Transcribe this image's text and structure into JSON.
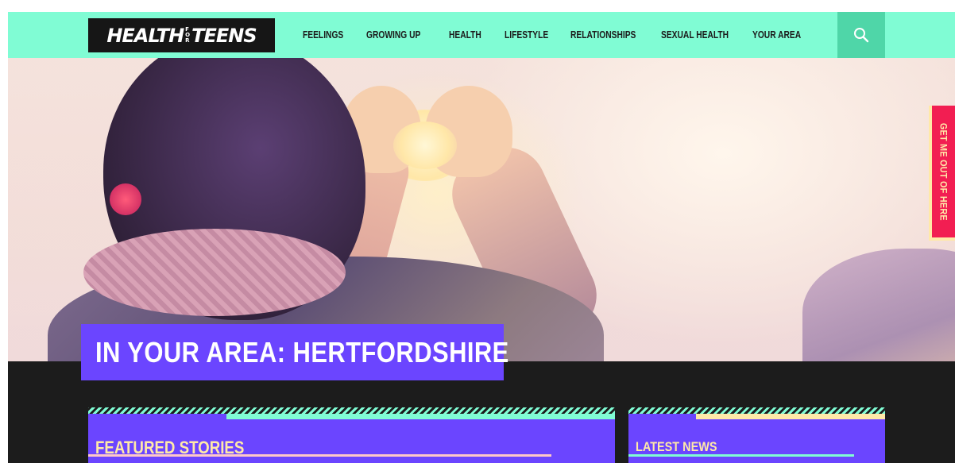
{
  "header": {
    "logo": {
      "left": "HEALTH",
      "for_top": "F",
      "for_mid": "O",
      "for_bot": "R",
      "right": "TEENS"
    },
    "nav": [
      "FEELINGS",
      "GROWING UP",
      "HEALTH",
      "LIFESTYLE",
      "RELATIONSHIPS",
      "SEXUAL HEALTH",
      "YOUR AREA"
    ],
    "search_icon": "search-icon"
  },
  "hero": {
    "title": "IN YOUR AREA: HERTFORDSHIRE"
  },
  "side_tab": {
    "label": "GET ME OUT OF HERE"
  },
  "panels": {
    "featured": {
      "title": "FEATURED STORIES"
    },
    "latest": {
      "title": "LATEST NEWS"
    }
  },
  "colors": {
    "header_bg": "#80fcd4",
    "search_bg": "#4fd6a8",
    "accent_purple": "#6b45ff",
    "panel_text": "#ffe9a8",
    "escape_red": "#f21e52",
    "dark_bg": "#1c1c1c"
  }
}
